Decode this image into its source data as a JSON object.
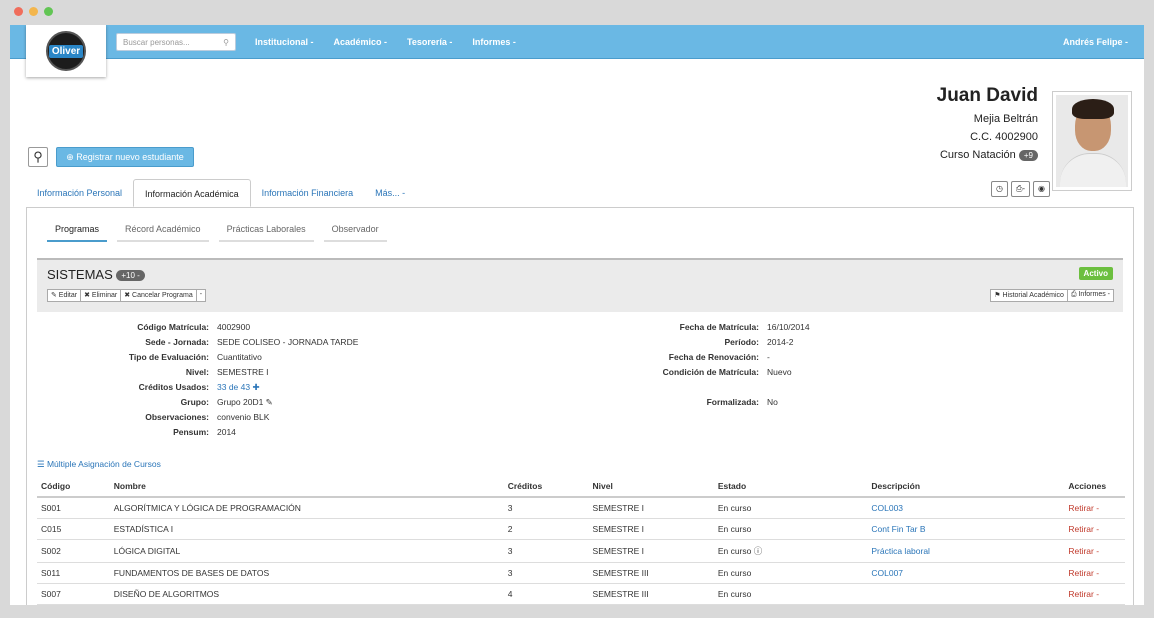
{
  "nav": {
    "search_placeholder": "Buscar personas...",
    "menus": [
      "Institucional -",
      "Académico -",
      "Tesorería -",
      "Informes -"
    ],
    "user": "Andrés Felipe -",
    "logo": "Oliver"
  },
  "student": {
    "first": "Juan David",
    "last": "Mejia Beltrán",
    "id": "C.C. 4002900",
    "course": "Curso Natación",
    "course_badge": "+9"
  },
  "actions": {
    "register": "⊕ Registrar nuevo estudiante"
  },
  "tabs": [
    "Información Personal",
    "Información Académica",
    "Información Financiera",
    "Más... -"
  ],
  "subtabs": [
    "Programas",
    "Récord Académico",
    "Prácticas Laborales",
    "Observador"
  ],
  "program": {
    "name": "SISTEMAS",
    "badge": "+10 -",
    "status": "Activo",
    "buttons": [
      "✎ Editar",
      "✖ Eliminar",
      "✖ Cancelar Programa",
      "-"
    ],
    "right_buttons": [
      "⚑ Historial Académico",
      "⎙ Informes -"
    ]
  },
  "details_left": [
    [
      "Código Matrícula:",
      "4002900"
    ],
    [
      "Sede - Jornada:",
      "SEDE COLISEO - JORNADA TARDE"
    ],
    [
      "Tipo de Evaluación:",
      "Cuantitativo"
    ],
    [
      "Nivel:",
      "SEMESTRE I"
    ],
    [
      "Créditos Usados:",
      "33 de 43 ✚"
    ],
    [
      "Grupo:",
      "Grupo 20D1 ✎"
    ],
    [
      "Observaciones:",
      "convenio BLK"
    ],
    [
      "Pensum:",
      "2014"
    ]
  ],
  "details_right": [
    [
      "Fecha de Matrícula:",
      "16/10/2014"
    ],
    [
      "Período:",
      "2014-2"
    ],
    [
      "Fecha de Renovación:",
      "-"
    ],
    [
      "Condición de Matrícula:",
      "Nuevo"
    ],
    [
      "",
      ""
    ],
    [
      "Formalizada:",
      "No"
    ]
  ],
  "multi_link": "☰ Múltiple Asignación de Cursos",
  "table_headers": [
    "Código",
    "Nombre",
    "Créditos",
    "Nivel",
    "Estado",
    "Descripción",
    "Acciones"
  ],
  "rows": [
    [
      "S001",
      "ALGORÍTMICA Y LÓGICA DE PROGRAMACIÓN",
      "3",
      "SEMESTRE I",
      "En curso",
      "COL003",
      "Retirar -"
    ],
    [
      "C015",
      "ESTADÍSTICA I",
      "2",
      "SEMESTRE I",
      "En curso",
      "Cont Fin Tar B",
      "Retirar -"
    ],
    [
      "S002",
      "LÓGICA DIGITAL",
      "3",
      "SEMESTRE I",
      "En curso ⓘ",
      "Práctica laboral",
      "Retirar -"
    ],
    [
      "S011",
      "FUNDAMENTOS DE BASES DE DATOS",
      "3",
      "SEMESTRE III",
      "En curso",
      "COL007",
      "Retirar -"
    ],
    [
      "S007",
      "DISEÑO DE ALGORITMOS",
      "4",
      "SEMESTRE III",
      "En curso",
      "",
      "Retirar -"
    ]
  ]
}
